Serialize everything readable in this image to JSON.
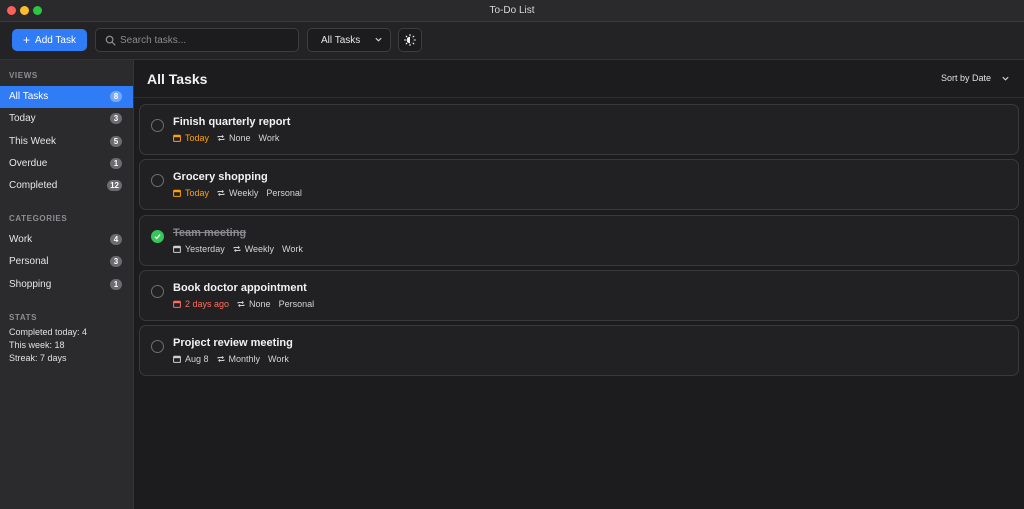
{
  "window": {
    "title": "To-Do List"
  },
  "toolbar": {
    "add_label": "Add Task",
    "search_placeholder": "Search tasks...",
    "filter_value": "All Tasks"
  },
  "sidebar": {
    "views_title": "VIEWS",
    "views": [
      {
        "label": "All Tasks",
        "count": "8",
        "active": true
      },
      {
        "label": "Today",
        "count": "3"
      },
      {
        "label": "This Week",
        "count": "5"
      },
      {
        "label": "Overdue",
        "count": "1"
      },
      {
        "label": "Completed",
        "count": "12"
      }
    ],
    "categories_title": "CATEGORIES",
    "categories": [
      {
        "label": "Work",
        "count": "4"
      },
      {
        "label": "Personal",
        "count": "3"
      },
      {
        "label": "Shopping",
        "count": "1"
      }
    ],
    "stats_title": "STATS",
    "stats": [
      "Completed today: 4",
      "This week: 18",
      "Streak: 7 days"
    ]
  },
  "main": {
    "title": "All Tasks",
    "sort_label": "Sort by Date"
  },
  "tasks": [
    {
      "title": "Finish quarterly report",
      "date": "Today",
      "date_style": "orange",
      "repeat": "None",
      "category": "Work",
      "done": false
    },
    {
      "title": "Grocery shopping",
      "date": "Today",
      "date_style": "orange",
      "repeat": "Weekly",
      "category": "Personal",
      "done": false
    },
    {
      "title": "Team meeting",
      "date": "Yesterday",
      "date_style": "normal",
      "repeat": "Weekly",
      "category": "Work",
      "done": true
    },
    {
      "title": "Book doctor appointment",
      "date": "2 days ago",
      "date_style": "red",
      "repeat": "None",
      "category": "Personal",
      "done": false
    },
    {
      "title": "Project review meeting",
      "date": "Aug 8",
      "date_style": "normal",
      "repeat": "Monthly",
      "category": "Work",
      "done": false
    }
  ],
  "colors": {
    "accent": "#2f7cf6",
    "done": "#34c759",
    "today": "#ff9f0a",
    "overdue": "#ff6b5c"
  }
}
